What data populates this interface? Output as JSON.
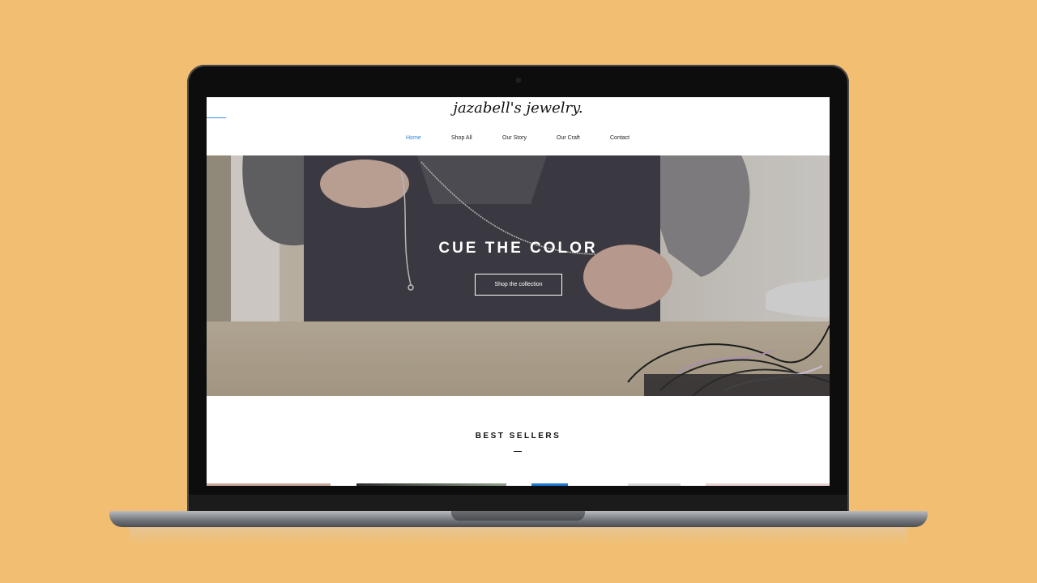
{
  "site": {
    "logo": "jazabell's jewelry.",
    "nav": [
      {
        "label": "Home",
        "active": true
      },
      {
        "label": "Shop All",
        "active": false
      },
      {
        "label": "Our Story",
        "active": false
      },
      {
        "label": "Our Craft",
        "active": false
      },
      {
        "label": "Contact",
        "active": false
      }
    ],
    "hero": {
      "title": "CUE THE COLOR",
      "button_label": "Shop the collection"
    },
    "best_sellers": {
      "title": "BEST SELLERS"
    }
  },
  "colors": {
    "background": "#f2bf72",
    "nav_active": "#2d86d6",
    "accent_line": "#3d8fe0"
  }
}
